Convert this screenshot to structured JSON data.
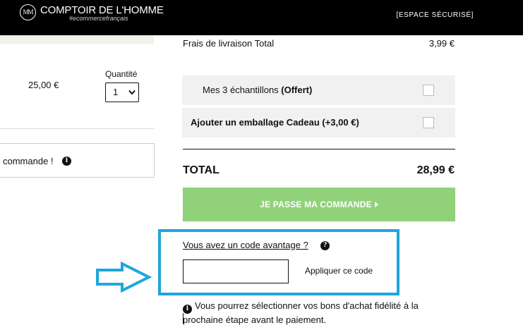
{
  "header": {
    "logo_mark": "MM",
    "brand": "COMPTOIR DE L'HOMME",
    "tagline": "#ecommercefrançais",
    "secure_label": "[ESPACE SÉCURISÉ]"
  },
  "cart": {
    "item_price": "25,00 €",
    "quantity_label": "Quantité",
    "quantity_value": "1",
    "notice_text": "commande !"
  },
  "summary": {
    "shipping_label": "Frais de livraison Total",
    "shipping_value": "3,99 €",
    "samples_label": "Mes 3 échantillons ",
    "samples_offer": "(Offert)",
    "gift_label": "Ajouter un emballage Cadeau (+3,00 €)",
    "total_label": "TOTAL",
    "total_value": "28,99 €",
    "order_button": "JE PASSE MA COMMANDE"
  },
  "promo": {
    "question": "Vous avez un code avantage ?",
    "input_value": "",
    "apply_label": "Appliquer ce code",
    "loyalty_note": "Vous pourrez sélectionner vos bons d'achat fidélité à la prochaine étape avant le paiement."
  },
  "colors": {
    "header_bg": "#000000",
    "order_button_bg": "#90d17a",
    "highlight": "#1ea6dc",
    "option_bg": "#f1f1f1"
  },
  "icons": {
    "info": "info-icon",
    "help": "help-icon",
    "select_arrow": "chevron-down-icon",
    "button_arrow": "triangle-right-icon",
    "pointer": "arrow-right-outline-icon"
  }
}
